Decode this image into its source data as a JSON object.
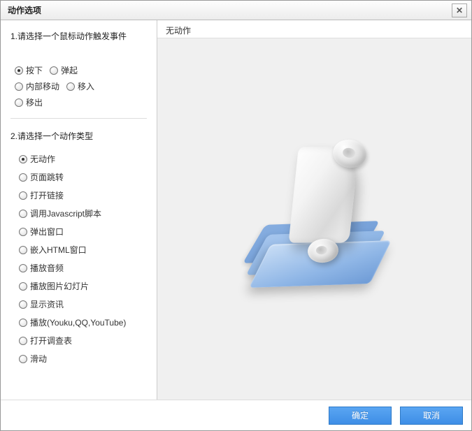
{
  "title": "动作选项",
  "section1_title": "1.请选择一个鼠标动作触发事件",
  "mouse_events": {
    "press": {
      "label": "按下",
      "checked": true
    },
    "release": {
      "label": "弹起",
      "checked": false
    },
    "move_in": {
      "label": "内部移动",
      "checked": false
    },
    "enter": {
      "label": "移入",
      "checked": false
    },
    "leave": {
      "label": "移出",
      "checked": false
    }
  },
  "section2_title": "2.请选择一个动作类型",
  "action_types": [
    {
      "key": "none",
      "label": "无动作",
      "checked": true
    },
    {
      "key": "page_jump",
      "label": "页面跳转",
      "checked": false
    },
    {
      "key": "open_link",
      "label": "打开链接",
      "checked": false
    },
    {
      "key": "call_js",
      "label": "调用Javascript脚本",
      "checked": false
    },
    {
      "key": "popup",
      "label": "弹出窗口",
      "checked": false
    },
    {
      "key": "embed_html",
      "label": "嵌入HTML窗口",
      "checked": false
    },
    {
      "key": "play_audio",
      "label": "播放音频",
      "checked": false
    },
    {
      "key": "slideshow",
      "label": "播放图片幻灯片",
      "checked": false
    },
    {
      "key": "show_info",
      "label": "显示资讯",
      "checked": false
    },
    {
      "key": "play_video",
      "label": "播放(Youku,QQ,YouTube)",
      "checked": false
    },
    {
      "key": "open_survey",
      "label": "打开调查表",
      "checked": false
    },
    {
      "key": "swipe",
      "label": "滑动",
      "checked": false
    }
  ],
  "right_header": "无动作",
  "buttons": {
    "ok": "确定",
    "cancel": "取消"
  }
}
